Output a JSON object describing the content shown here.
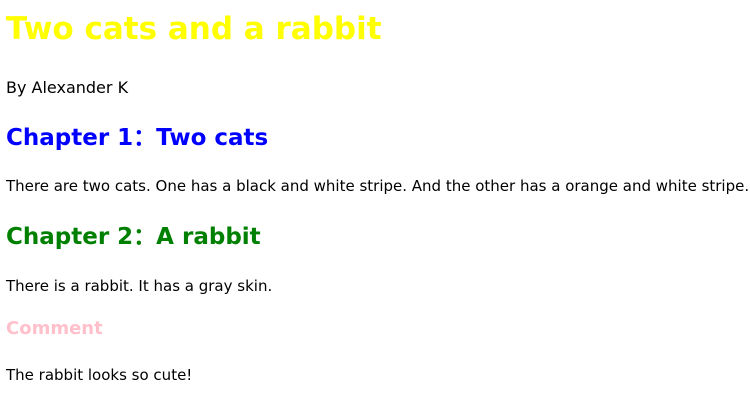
{
  "document": {
    "title": "Two cats and a rabbit",
    "author": "By Alexander K",
    "sections": [
      {
        "heading": "Chapter 1：Two cats",
        "text": "There are two cats. One has a black and white stripe. And the other has a orange and white stripe."
      },
      {
        "heading": "Chapter 2：A rabbit",
        "text": "There is a rabbit. It has a gray skin."
      }
    ],
    "comment": {
      "heading": "Comment",
      "text": "The rabbit looks so cute!"
    }
  },
  "colors": {
    "title": "#ffff00",
    "chapter_1": "#0000ff",
    "chapter_2": "#008000",
    "comment": "#ffc0cb",
    "body_text": "#000000",
    "background": "#ffffff"
  }
}
